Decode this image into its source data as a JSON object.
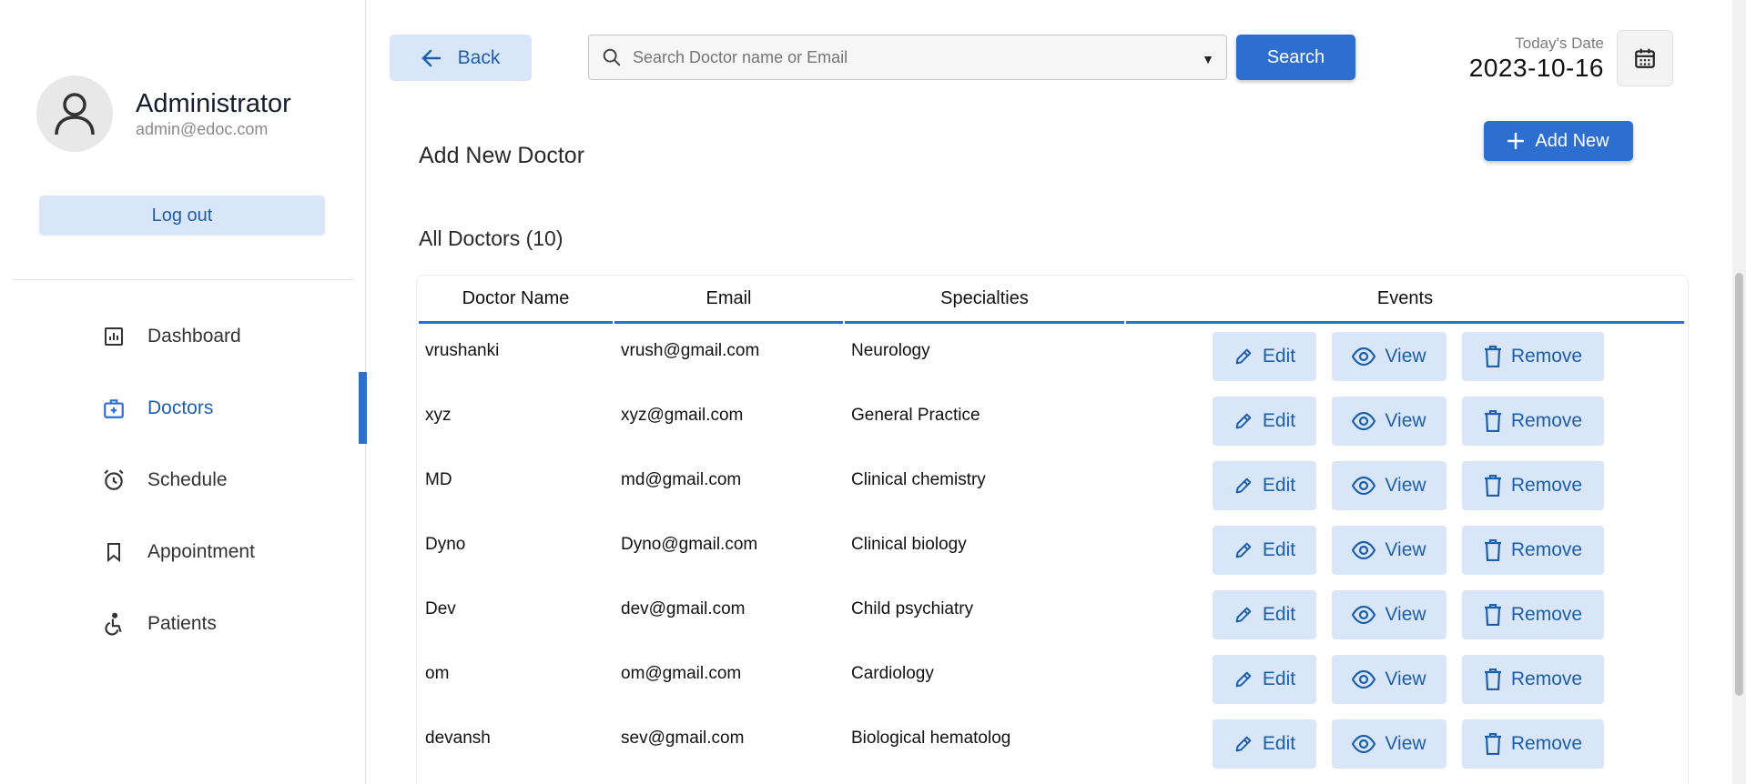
{
  "profile": {
    "name": "Administrator",
    "email": "admin@edoc.com"
  },
  "sidebar": {
    "logout_label": "Log out",
    "items": [
      {
        "label": "Dashboard",
        "icon": "dashboard-icon"
      },
      {
        "label": "Doctors",
        "icon": "doctor-bag-icon",
        "active": true
      },
      {
        "label": "Schedule",
        "icon": "alarm-clock-icon"
      },
      {
        "label": "Appointment",
        "icon": "bookmark-icon"
      },
      {
        "label": "Patients",
        "icon": "wheelchair-icon"
      }
    ]
  },
  "topbar": {
    "back_label": "Back",
    "search_placeholder": "Search Doctor name or Email",
    "search_label": "Search",
    "date_label": "Today's Date",
    "date_value": "2023-10-16"
  },
  "main": {
    "add_title": "Add New Doctor",
    "add_new_label": "Add New",
    "all_title": "All Doctors (10)"
  },
  "table": {
    "headers": [
      "Doctor Name",
      "Email",
      "Specialties",
      "Events"
    ],
    "actions": {
      "edit": "Edit",
      "view": "View",
      "remove": "Remove"
    },
    "rows": [
      {
        "name": "vrushanki",
        "email": "vrush@gmail.com",
        "specialty": "Neurology"
      },
      {
        "name": "xyz",
        "email": "xyz@gmail.com",
        "specialty": "General Practice"
      },
      {
        "name": "MD",
        "email": "md@gmail.com",
        "specialty": "Clinical chemistry"
      },
      {
        "name": "Dyno",
        "email": "Dyno@gmail.com",
        "specialty": "Clinical biology"
      },
      {
        "name": "Dev",
        "email": "dev@gmail.com",
        "specialty": "Child psychiatry"
      },
      {
        "name": "om",
        "email": "om@gmail.com",
        "specialty": "Cardiology"
      },
      {
        "name": "devansh",
        "email": "sev@gmail.com",
        "specialty": "Biological hematolog"
      }
    ]
  },
  "colors": {
    "accent": "#2c6fd0",
    "soft_accent": "#d8e6f7",
    "accent_text": "#1d5fab"
  }
}
